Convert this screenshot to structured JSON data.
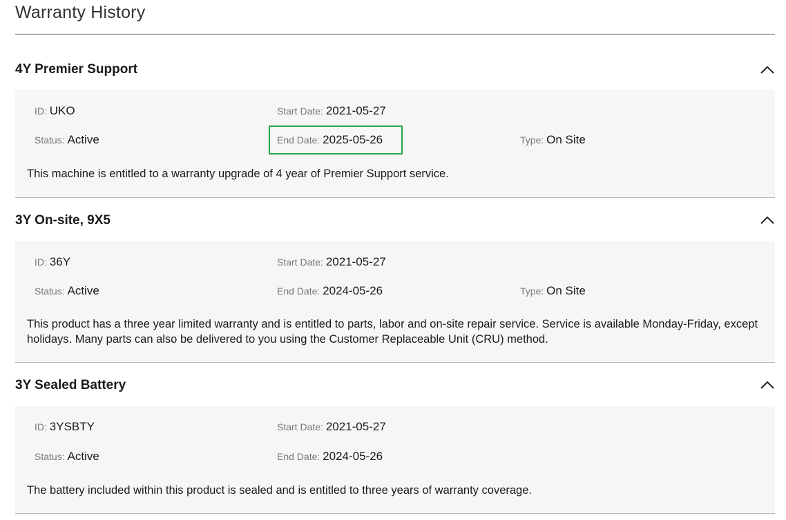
{
  "page": {
    "title": "Warranty History"
  },
  "highlight_color": "#28a745",
  "sections": [
    {
      "title": "4Y Premier Support",
      "expanded": true,
      "id_label": "ID",
      "id_value": "UKO",
      "start_label": "Start Date",
      "start_value": "2021-05-27",
      "status_label": "Status",
      "status_value": "Active",
      "end_label": "End Date",
      "end_value": "2025-05-26",
      "type_label": "Type",
      "type_value": "On Site",
      "description": "This machine is entitled to a warranty upgrade of 4 year of Premier Support service."
    },
    {
      "title": "3Y On-site, 9X5",
      "expanded": true,
      "id_label": "ID",
      "id_value": "36Y",
      "start_label": "Start Date",
      "start_value": "2021-05-27",
      "status_label": "Status",
      "status_value": "Active",
      "end_label": "End Date",
      "end_value": "2024-05-26",
      "type_label": "Type",
      "type_value": "On Site",
      "description": "This product has a three year limited warranty and is entitled to parts, labor and on-site repair service. Service is available Monday-Friday, except holidays. Many parts can also be delivered to you using the Customer Replaceable Unit (CRU) method."
    },
    {
      "title": "3Y Sealed Battery",
      "expanded": true,
      "id_label": "ID",
      "id_value": "3YSBTY",
      "start_label": "Start Date",
      "start_value": "2021-05-27",
      "status_label": "Status",
      "status_value": "Active",
      "end_label": "End Date",
      "end_value": "2024-05-26",
      "description": "The battery included within this product is sealed and is entitled to three years of warranty coverage."
    }
  ]
}
